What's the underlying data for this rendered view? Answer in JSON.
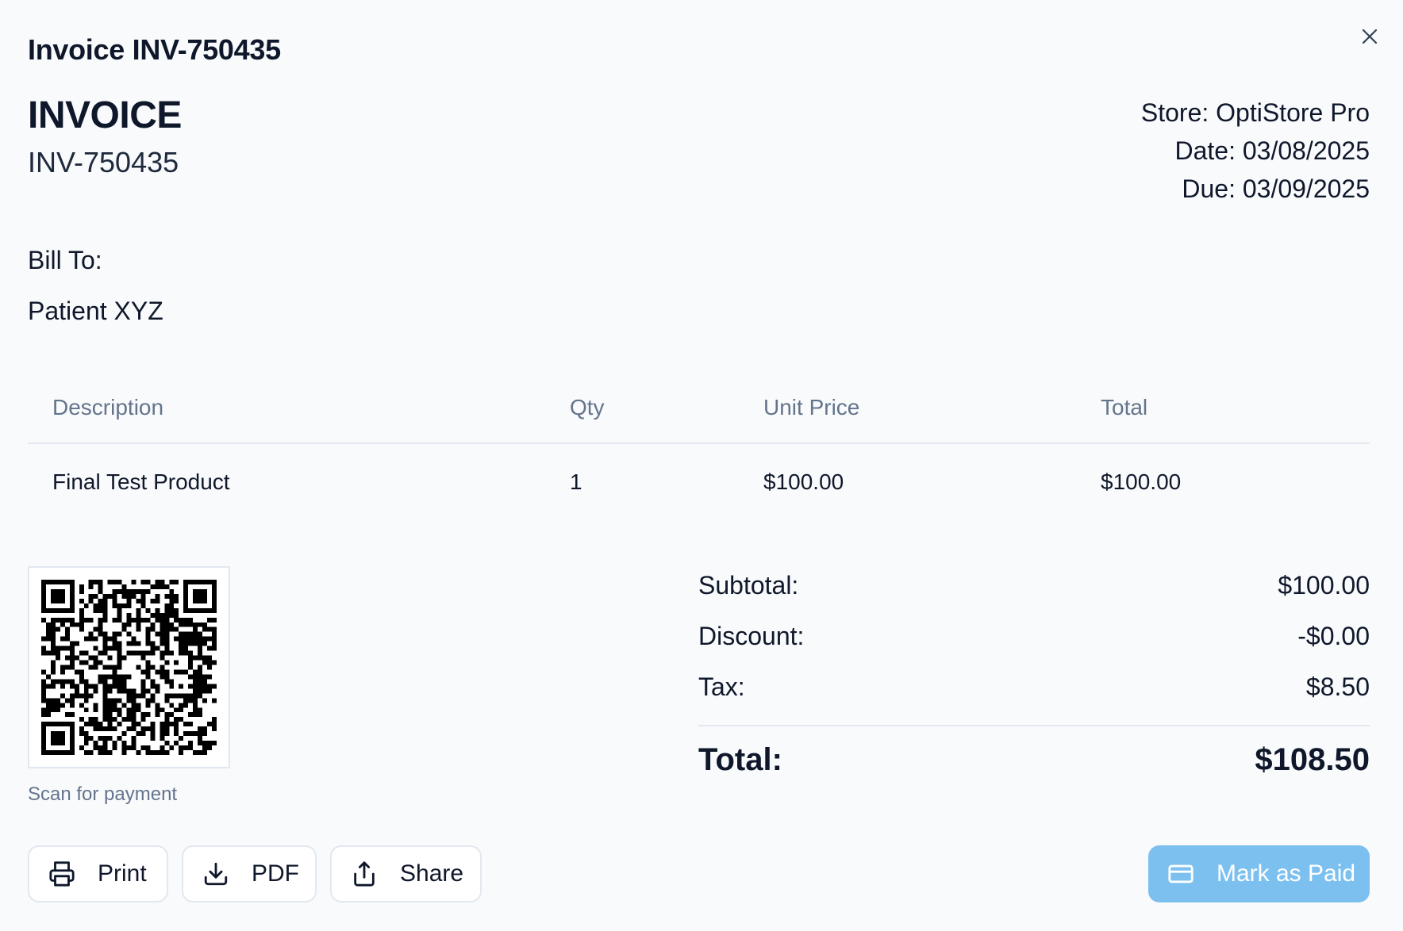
{
  "dialog": {
    "title": "Invoice INV-750435"
  },
  "invoice": {
    "heading": "INVOICE",
    "number": "INV-750435",
    "store": "Store: OptiStore Pro",
    "date": "Date: 03/08/2025",
    "due": "Due: 03/09/2025"
  },
  "bill_to": {
    "label": "Bill To:",
    "name": "Patient XYZ"
  },
  "table": {
    "headers": [
      "Description",
      "Qty",
      "Unit Price",
      "Total"
    ],
    "rows": [
      {
        "description": "Final Test Product",
        "qty": "1",
        "unit_price": "$100.00",
        "total": "$100.00"
      }
    ]
  },
  "qr": {
    "caption": "Scan for payment",
    "icon": "qr-code"
  },
  "totals": {
    "subtotal_label": "Subtotal:",
    "subtotal": "$100.00",
    "discount_label": "Discount:",
    "discount": "-$0.00",
    "tax_label": "Tax:",
    "tax": "$8.50",
    "total_label": "Total:",
    "total": "$108.50"
  },
  "actions": {
    "print": "Print",
    "pdf": "PDF",
    "share": "Share",
    "mark_paid": "Mark as Paid"
  },
  "icons": {
    "close": "close-icon",
    "print": "printer-icon",
    "pdf": "download-icon",
    "share": "share-icon",
    "mark_paid": "credit-card-icon"
  },
  "colors": {
    "accent": "#7cc0f0",
    "muted": "#64748b",
    "border": "#e2e8f0",
    "background": "#f8fafc"
  }
}
